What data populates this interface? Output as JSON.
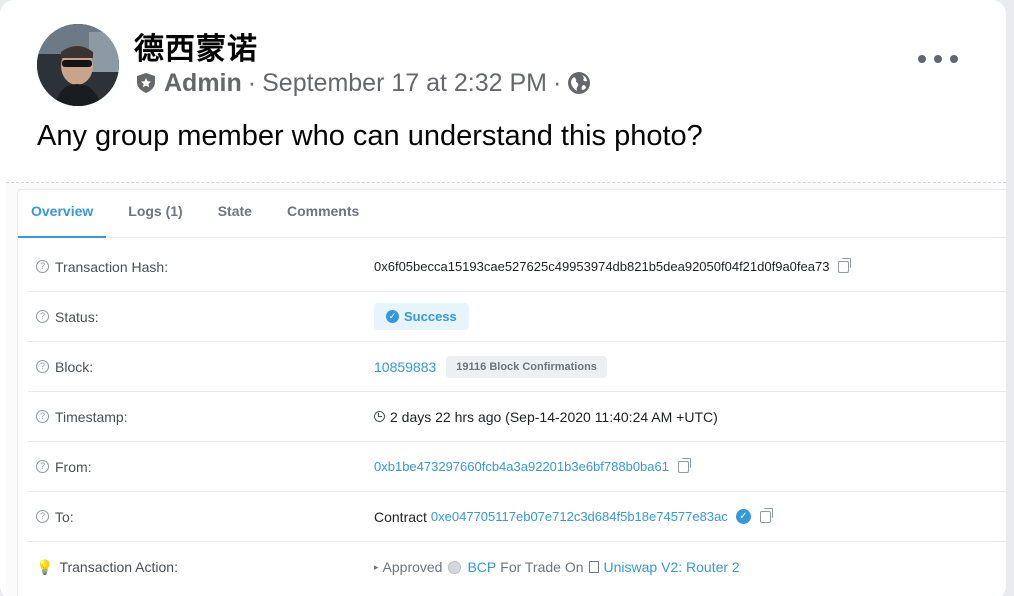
{
  "post": {
    "author": "德西蒙诺",
    "role": "Admin",
    "separator": "·",
    "time": "September 17 at 2:32 PM",
    "privacy_icon": "globe-icon",
    "role_icon": "shield-icon",
    "menu_icon": "more-horizontal-icon",
    "caption": "Any group member who can understand this photo?"
  },
  "tx": {
    "tabs": [
      {
        "label": "Overview",
        "active": true
      },
      {
        "label": "Logs (1)"
      },
      {
        "label": "State"
      },
      {
        "label": "Comments"
      }
    ],
    "rows": {
      "hash": {
        "label": "Transaction Hash:",
        "value": "0x6f05becca15193cae527625c49953974db821b5dea92050f04f21d0f9a0fea73"
      },
      "status": {
        "label": "Status:",
        "value": "Success"
      },
      "block": {
        "label": "Block:",
        "value": "10859883",
        "confirmations": "19116 Block Confirmations"
      },
      "timestamp": {
        "label": "Timestamp:",
        "value": "2 days 22 hrs ago (Sep-14-2020 11:40:24 AM +UTC)"
      },
      "from": {
        "label": "From:",
        "value": "0xb1be473297660fcb4a3a92201b3e6bf788b0ba61"
      },
      "to": {
        "label": "To:",
        "prefix": "Contract",
        "value": "0xe047705117eb07e712c3d684f5b18e74577e83ac"
      },
      "action": {
        "label": "Transaction Action:",
        "verb": "Approved",
        "token": "BCP",
        "middle": "For Trade On",
        "target": "Uniswap V2: Router 2"
      }
    },
    "accent_color": "#3498db"
  }
}
